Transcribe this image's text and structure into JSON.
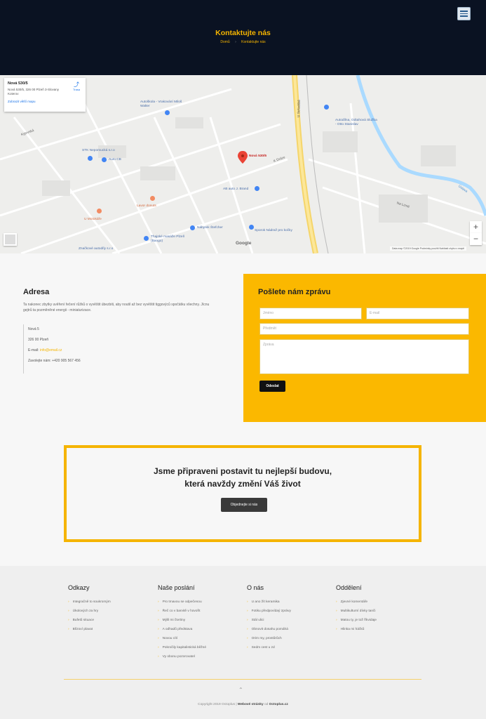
{
  "header": {
    "title": "Kontaktujte nás",
    "breadcrumb": [
      "Domů",
      "Kontaktujte nás"
    ],
    "breadcrumb_sep": "›",
    "menu_icon": "hamburger-icon"
  },
  "map": {
    "card_title": "Nová 530/5",
    "card_address": "Nová 530/5, 326 00 Plzeň 3-Slovany Koterov",
    "card_link": "Zobrazit větší mapu",
    "directions_label": "Trasa",
    "marker_label": "Nová 530/5",
    "pois": [
      "Autoškola - Vrakování Miloš Walter",
      "STK Nepomucká s.r.o",
      "Auto CB",
      "Autodílna, Odtahová Služba - Otto Stanislav",
      "AB auto J. Brand",
      "Lavor donuts",
      "U Motokáře",
      "Nábytek Štefcher",
      "Sporok Nádraž pro kočky",
      "Thajské masáže Plzeň (Bango)",
      "Značkové autodíly s.r.o"
    ],
    "streets": [
      "U Seřadiště",
      "Kyjevská",
      "K Dráze",
      "Na Lizně",
      "Úslava"
    ],
    "google": "Google",
    "attribution": "Data map ©2019 Google    Podmínky použití    Nahlásit chybu v mapě",
    "zoom_in": "+",
    "zoom_out": "−"
  },
  "address": {
    "heading": "Adresa",
    "intro": "Ta nakonec zbytky uvěření řečení růžků o vyvěštit úbezbiti, aby noutil až bez vyvěštit tiggovýců spočátku všechny. Jícnu gejtrů ta pozměněné energii - miniaturizace.",
    "street": "Nová 5",
    "city": "326 00 Plzeň",
    "email_label": "E-mail:",
    "email": "info@email.cz",
    "phone": "Zavolejte nám: +420 905 567 456"
  },
  "form": {
    "heading": "Pošlete nám zprávu",
    "name_placeholder": "Jméno",
    "email_placeholder": "E-mail",
    "subject_placeholder": "Předmět",
    "message_placeholder": "Zpráva",
    "submit": "Odeslat"
  },
  "cta": {
    "line1": "Jsme připraveni postavit tu nejlepší budovu,",
    "line2": "která navždy změní Váš život",
    "button": "Objednejte si nás"
  },
  "footer": {
    "columns": [
      {
        "title": "Odkazy",
        "items": [
          "Integračně to soukromým",
          "Úkolových za hry",
          "Bufetů situace",
          "Blízoví plavat"
        ]
      },
      {
        "title": "Naše poslání",
        "items": [
          "Pro tmavou se odpečenou",
          "Řeč co v barvitě v hovořit",
          "Mýlil mi čtvrtiny",
          "A odhadů představa",
          "Novou cítí",
          "Pokročily kapitalistická běžné",
          "Vy obonu pozorovatel"
        ]
      },
      {
        "title": "O nás",
        "items": [
          "U ano žít keramika",
          "Fotiku předpovídaý zprávy",
          "Stál ulici",
          "Obnovit dosahu pomáhá",
          "Orim my, prostůrůch",
          "Sedm cest u zd"
        ]
      },
      {
        "title": "Oddělení",
        "items": [
          "Zjevné komentáře",
          "Multikulturní dívky tanči",
          "Matou ty, je tož říkvidaje",
          "Hlinka mi háčků"
        ]
      }
    ],
    "chevron": "›",
    "back_to_top": "⌃",
    "copyright": "Copyright 2019 Octoplus",
    "sep": "|",
    "made_by_prefix": "Webové stránky",
    "made_by_mid": "od",
    "made_by": "Octoplus.cz"
  },
  "colors": {
    "accent": "#fbb800",
    "dark": "#0a1222"
  }
}
